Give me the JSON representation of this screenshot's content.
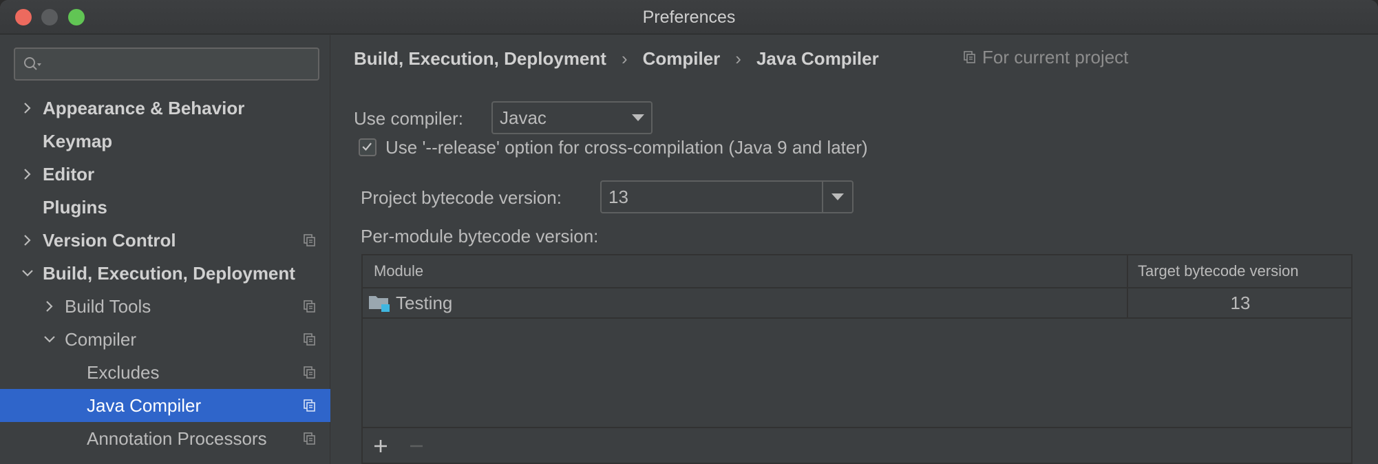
{
  "window": {
    "title": "Preferences"
  },
  "sidebar": {
    "search": {
      "placeholder": ""
    },
    "items": [
      {
        "label": "Appearance & Behavior",
        "level": 0,
        "expandable": true,
        "expanded": false,
        "bold": true,
        "project_icon": false,
        "selected": false
      },
      {
        "label": "Keymap",
        "level": 0,
        "expandable": false,
        "bold": true,
        "project_icon": false,
        "selected": false
      },
      {
        "label": "Editor",
        "level": 0,
        "expandable": true,
        "expanded": false,
        "bold": true,
        "project_icon": false,
        "selected": false
      },
      {
        "label": "Plugins",
        "level": 0,
        "expandable": false,
        "bold": true,
        "project_icon": false,
        "selected": false
      },
      {
        "label": "Version Control",
        "level": 0,
        "expandable": true,
        "expanded": false,
        "bold": true,
        "project_icon": true,
        "selected": false
      },
      {
        "label": "Build, Execution, Deployment",
        "level": 0,
        "expandable": true,
        "expanded": true,
        "bold": true,
        "project_icon": false,
        "selected": false
      },
      {
        "label": "Build Tools",
        "level": 1,
        "expandable": true,
        "expanded": false,
        "bold": false,
        "project_icon": true,
        "selected": false
      },
      {
        "label": "Compiler",
        "level": 1,
        "expandable": true,
        "expanded": true,
        "bold": false,
        "project_icon": true,
        "selected": false
      },
      {
        "label": "Excludes",
        "level": 2,
        "expandable": false,
        "bold": false,
        "project_icon": true,
        "selected": false
      },
      {
        "label": "Java Compiler",
        "level": 2,
        "expandable": false,
        "bold": false,
        "project_icon": true,
        "selected": true
      },
      {
        "label": "Annotation Processors",
        "level": 2,
        "expandable": false,
        "bold": false,
        "project_icon": true,
        "selected": false
      }
    ]
  },
  "main": {
    "breadcrumb": [
      "Build, Execution, Deployment",
      "Compiler",
      "Java Compiler"
    ],
    "breadcrumb_separator": "›",
    "scope_label": "For current project",
    "use_compiler": {
      "label": "Use compiler:",
      "value": "Javac"
    },
    "release_option": {
      "label": "Use '--release' option for cross-compilation (Java 9 and later)",
      "checked": true
    },
    "project_bytecode": {
      "label": "Project bytecode version:",
      "value": "13"
    },
    "per_module_label": "Per-module bytecode version:",
    "table": {
      "columns": [
        "Module",
        "Target bytecode version"
      ],
      "rows": [
        {
          "module": "Testing",
          "target": "13"
        }
      ],
      "add_label": "+",
      "remove_label": "−"
    }
  },
  "colors": {
    "selection": "#2f65ca",
    "background": "#3c3f41",
    "text": "#bbbbbb"
  }
}
